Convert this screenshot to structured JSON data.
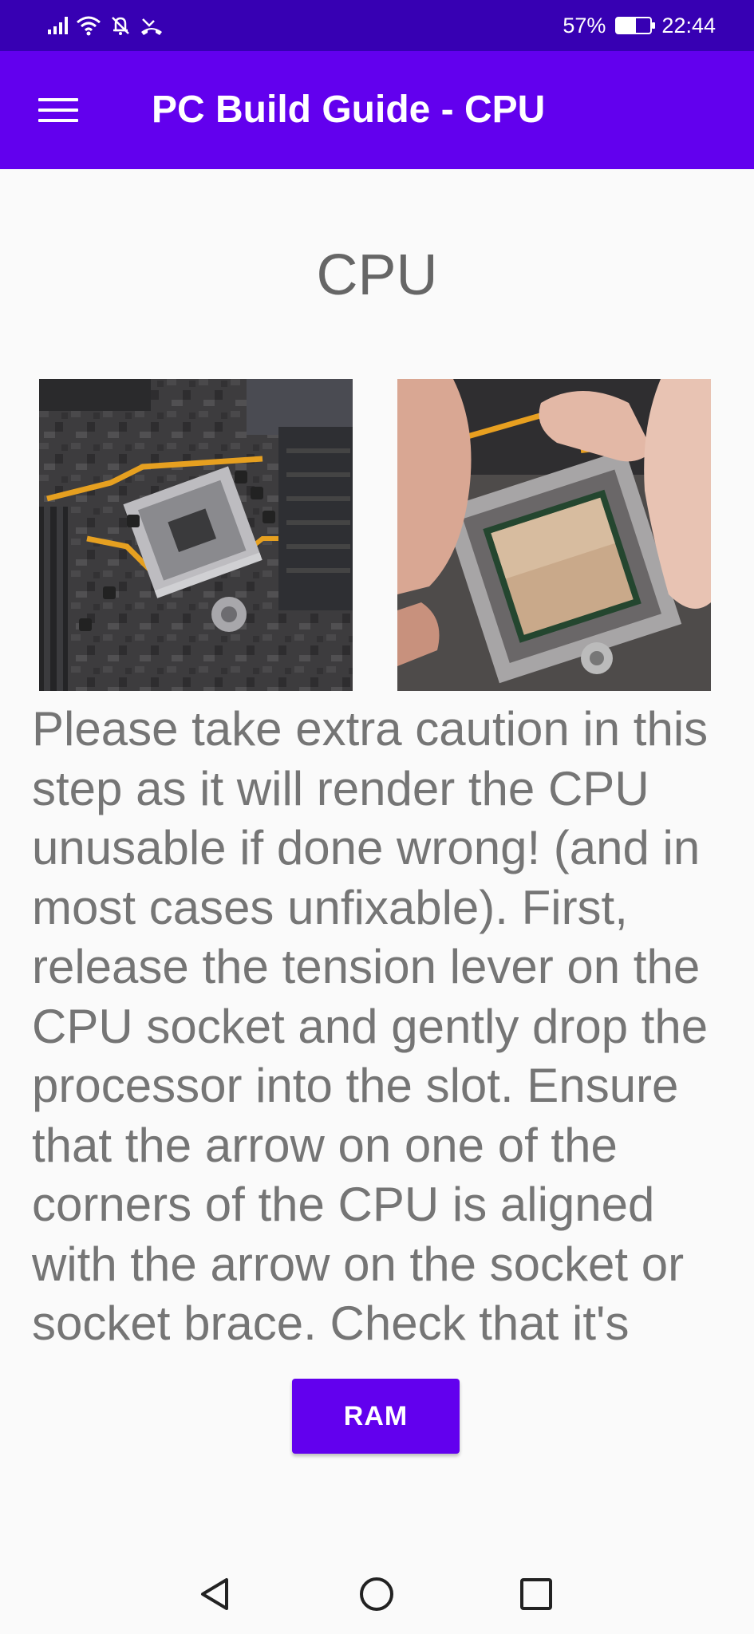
{
  "status_bar": {
    "battery_percent": "57%",
    "battery_level": 0.57,
    "time": "22:44",
    "icons": [
      "signal-icon",
      "wifi-icon",
      "notifications-off-icon",
      "missed-call-icon",
      "battery-charging-icon"
    ]
  },
  "app_bar": {
    "menu_icon": "hamburger-menu-icon",
    "title": "PC Build Guide - CPU"
  },
  "main": {
    "section_title": "CPU",
    "images": [
      "motherboard-cpu-socket-photo",
      "hand-placing-cpu-photo"
    ],
    "instructions": "Please take extra caution in this step as it will render the CPU unusable if done wrong! (and in most cases unfixable). First, release the tension lever on the CPU socket and gently drop the processor into the slot. Ensure that the arrow on one of the corners of the CPU is aligned with the arrow on the socket or socket brace. Check that it's",
    "next_button_label": "RAM"
  },
  "nav_bar": {
    "buttons": [
      "back-icon",
      "home-icon",
      "recents-icon"
    ]
  },
  "colors": {
    "status_bar": "#3700b3",
    "app_bar": "#6200ee",
    "button": "#6200ee",
    "text": "#757575"
  }
}
